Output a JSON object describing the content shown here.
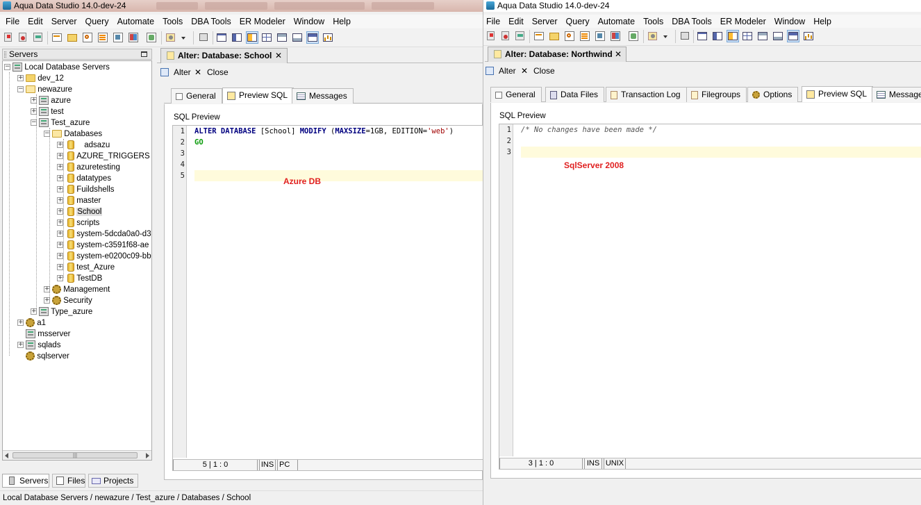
{
  "left_window": {
    "title": "Aqua Data Studio 14.0-dev-24",
    "menu": [
      "File",
      "Edit",
      "Server",
      "Query",
      "Automate",
      "Tools",
      "DBA Tools",
      "ER Modeler",
      "Window",
      "Help"
    ],
    "servers_panel": {
      "title": "Servers",
      "tree": {
        "root": "Local Database Servers",
        "dev_12": "dev_12",
        "newazure": "newazure",
        "azure": "azure",
        "test": "test",
        "test_azure": "Test_azure",
        "databases": "Databases",
        "dbs": [
          "adsazu",
          "AZURE_TRIGGERS",
          "azuretesting",
          "datatypes",
          "Fuildshells",
          "master",
          "School",
          "scripts",
          "system-5dcda0a0-d3",
          "system-c3591f68-ae",
          "system-e0200c09-bb",
          "test_Azure",
          "TestDB"
        ],
        "management": "Management",
        "security": "Security",
        "type_azure": "Type_azure",
        "a1": "a1",
        "msserver": "msserver",
        "sqlads": "sqlads",
        "sqlserver": "sqlserver"
      },
      "bottom_tabs": [
        "Servers",
        "Files",
        "Projects"
      ]
    },
    "doc_tab": "Alter: Database: School",
    "actions": {
      "alter": "Alter",
      "close": "Close"
    },
    "subtabs": [
      "General",
      "Preview SQL",
      "Messages"
    ],
    "sql_preview_label": "SQL Preview",
    "lines": [
      "1",
      "2",
      "3",
      "4",
      "5"
    ],
    "code": {
      "l1_kw1": "ALTER DATABASE",
      "l1_ident": " [School] ",
      "l1_kw2": "MODIFY",
      "l1_p1": " (",
      "l1_kw3": "MAXSIZE",
      "l1_p2": "=1GB, EDITION=",
      "l1_str": "'web'",
      "l1_p3": ")",
      "l2": "GO"
    },
    "annotation": "Azure DB",
    "status": {
      "pos": "5 | 1 : 0",
      "mode": "INS",
      "eol": "PC"
    },
    "breadcrumb": "Local Database Servers / newazure / Test_azure / Databases / School"
  },
  "right_window": {
    "title": "Aqua Data Studio 14.0-dev-24",
    "menu": [
      "File",
      "Edit",
      "Server",
      "Query",
      "Automate",
      "Tools",
      "DBA Tools",
      "ER Modeler",
      "Window",
      "Help"
    ],
    "doc_tab": "Alter: Database: Northwind",
    "actions": {
      "alter": "Alter",
      "close": "Close"
    },
    "subtabs": [
      "General",
      "Data Files",
      "Transaction Log",
      "Filegroups",
      "Options",
      "Preview SQL",
      "Messages"
    ],
    "sql_preview_label": "SQL Preview",
    "lines": [
      "1",
      "2",
      "3"
    ],
    "code": {
      "l1": "/* No changes have been made */"
    },
    "annotation": "SqlServer 2008",
    "status": {
      "pos": "3 | 1 : 0",
      "mode": "INS",
      "eol": "UNIX"
    }
  }
}
